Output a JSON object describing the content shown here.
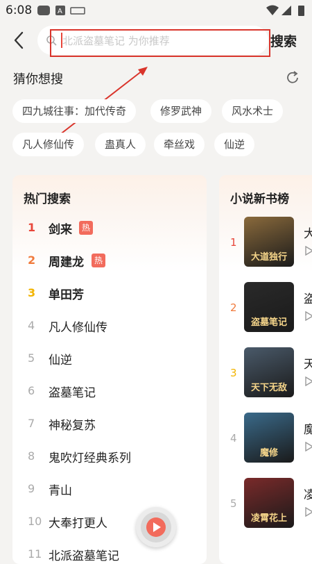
{
  "status_bar": {
    "time": "6:08"
  },
  "search": {
    "back_icon": "back-arrow-icon",
    "placeholder": "北派盗墓笔记  为你推荐",
    "button_label": "搜索"
  },
  "guess": {
    "title": "猜你想搜",
    "chips": [
      "四九城往事：加代传奇",
      "修罗武神",
      "风水术士",
      "凡人修仙传",
      "蛊真人",
      "牵丝戏",
      "仙逆"
    ]
  },
  "hot_search": {
    "title": "热门搜索",
    "badge_label": "热",
    "items": [
      {
        "rank": "1",
        "name": "剑来",
        "hot": true,
        "color": "#e8463a"
      },
      {
        "rank": "2",
        "name": "周建龙",
        "hot": true,
        "color": "#f07a3c"
      },
      {
        "rank": "3",
        "name": "单田芳",
        "hot": false,
        "color": "#f2b400"
      },
      {
        "rank": "4",
        "name": "凡人修仙传",
        "hot": false,
        "color": "#aaaaaa"
      },
      {
        "rank": "5",
        "name": "仙逆",
        "hot": false,
        "color": "#aaaaaa"
      },
      {
        "rank": "6",
        "name": "盗墓笔记",
        "hot": false,
        "color": "#aaaaaa"
      },
      {
        "rank": "7",
        "name": "神秘复苏",
        "hot": false,
        "color": "#aaaaaa"
      },
      {
        "rank": "8",
        "name": "鬼吹灯经典系列",
        "hot": false,
        "color": "#aaaaaa"
      },
      {
        "rank": "9",
        "name": "青山",
        "hot": false,
        "color": "#aaaaaa"
      },
      {
        "rank": "10",
        "name": "大奉打更人",
        "hot": false,
        "color": "#aaaaaa"
      },
      {
        "rank": "11",
        "name": "北派盗墓笔记",
        "hot": false,
        "color": "#aaaaaa"
      }
    ]
  },
  "new_books": {
    "title": "小说新书榜",
    "items": [
      {
        "rank": "1",
        "title": "大",
        "color": "#e8463a",
        "cover_text": "大道独行",
        "cover_bg": "#8a6a3c"
      },
      {
        "rank": "2",
        "title": "盗",
        "color": "#f07a3c",
        "cover_text": "盗墓笔记",
        "cover_bg": "#2a2a2a"
      },
      {
        "rank": "3",
        "title": "天",
        "color": "#f2b400",
        "cover_text": "天下无敌",
        "cover_bg": "#4a5a6a"
      },
      {
        "rank": "4",
        "title": "魔",
        "color": "#aaaaaa",
        "cover_text": "魔修",
        "cover_bg": "#3a6a8a"
      },
      {
        "rank": "5",
        "title": "凌",
        "color": "#aaaaaa",
        "cover_text": "凌霄花上",
        "cover_bg": "#7a2a2a"
      }
    ]
  },
  "colors": {
    "accent": "#f26b5c",
    "annotation": "#d9342b"
  }
}
